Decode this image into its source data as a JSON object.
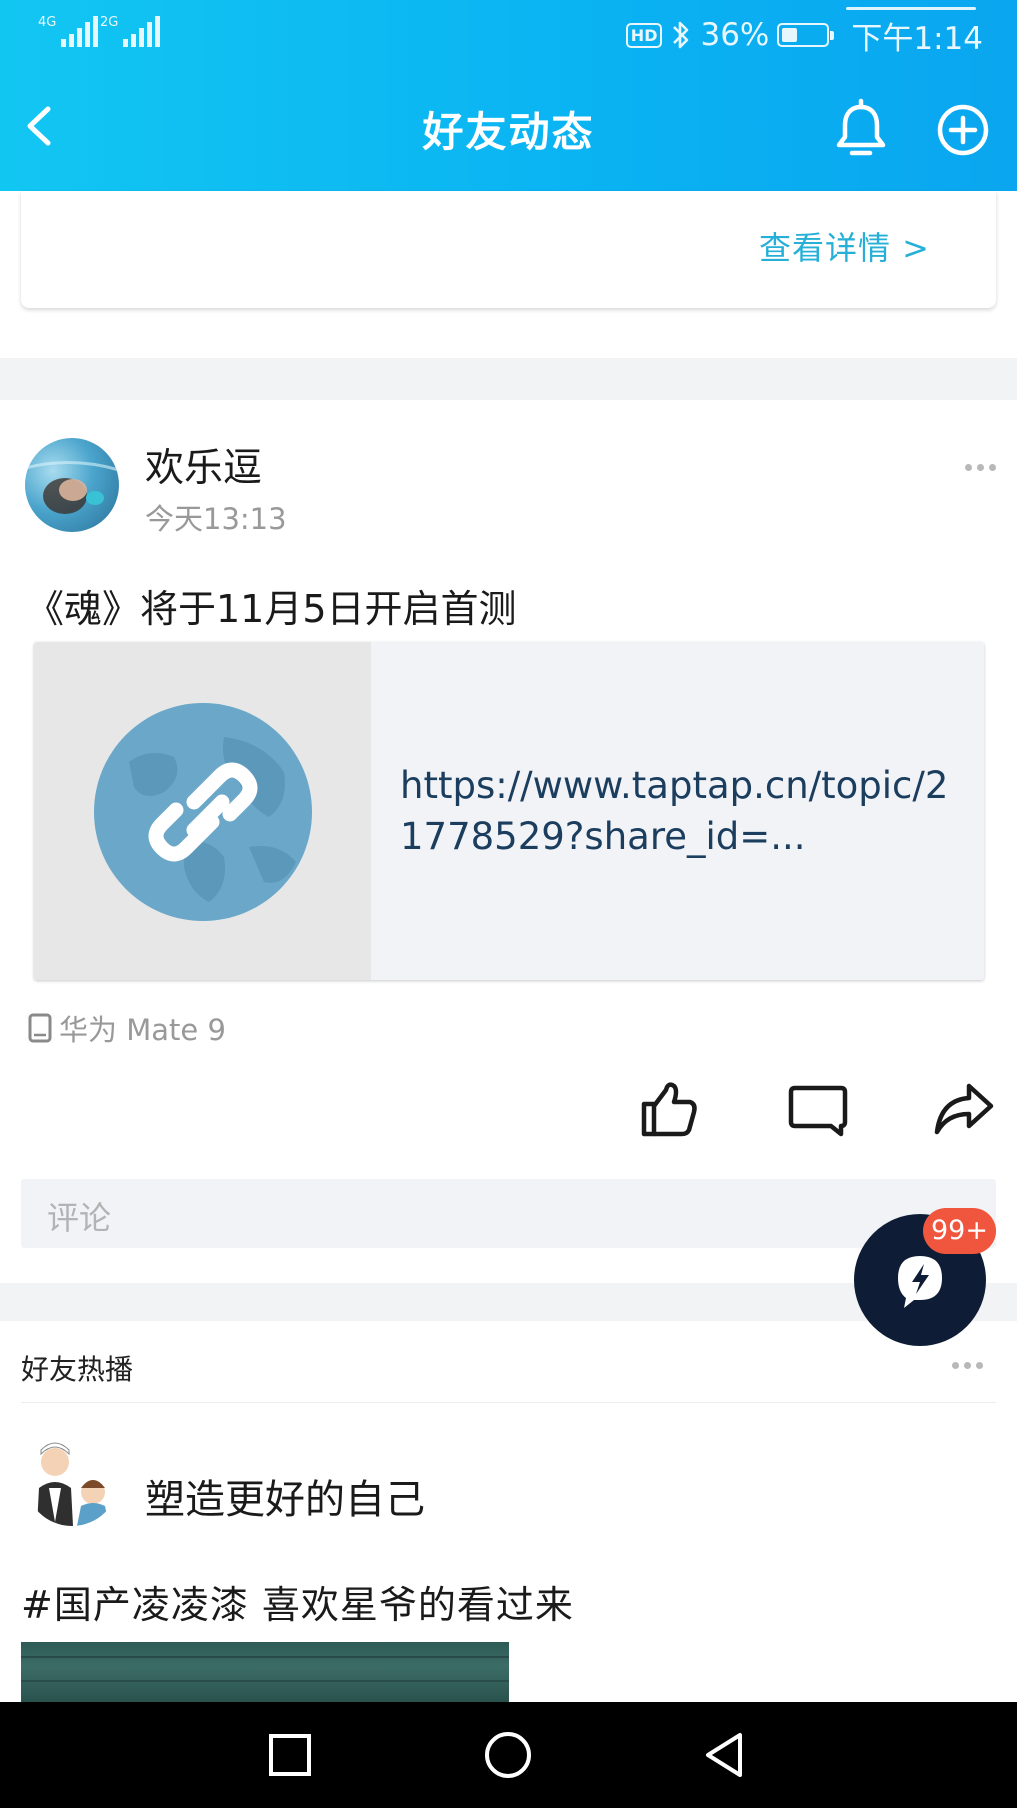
{
  "status_bar": {
    "signal1_label": "4G",
    "signal2_label": "2G",
    "hd_badge": "HD",
    "bluetooth_icon": "bluetooth-icon",
    "battery_text": "36%",
    "battery_level": 0.36,
    "time": "下午1:14"
  },
  "nav": {
    "title": "好友动态",
    "back_icon": "chevron-left-icon",
    "bell_icon": "bell-icon",
    "add_icon": "plus-circle-icon"
  },
  "top_card": {
    "details_link": "查看详情 >"
  },
  "post": {
    "user_name": "欢乐逗",
    "time": "今天13:13",
    "text": "《魂》将于11月5日开启首测",
    "link_url": "https://www.taptap.cn/topic/21778529?share_id=...",
    "link_icon": "link-globe-icon",
    "device": "华为 Mate 9",
    "device_icon": "phone-icon",
    "actions": {
      "like_icon": "thumbs-up-icon",
      "comment_icon": "comment-icon",
      "share_icon": "share-arrow-icon"
    },
    "comment_placeholder": "评论"
  },
  "fab": {
    "badge": "99+",
    "icon": "flash-chat-icon"
  },
  "hot_section": {
    "title": "好友热播",
    "user_name": "塑造更好的自己",
    "text": "#国产凌凌漆  喜欢星爷的看过来"
  },
  "system_nav": {
    "recent_icon": "square-icon",
    "home_icon": "circle-icon",
    "back_icon": "triangle-back-icon"
  },
  "colors": {
    "header_start": "#12c6f2",
    "header_end": "#0aa6ef",
    "link_blue": "#26b0d8",
    "url_text": "#1b3d5e",
    "badge_red": "#f0553d",
    "fab_dark": "#0e1d35"
  }
}
